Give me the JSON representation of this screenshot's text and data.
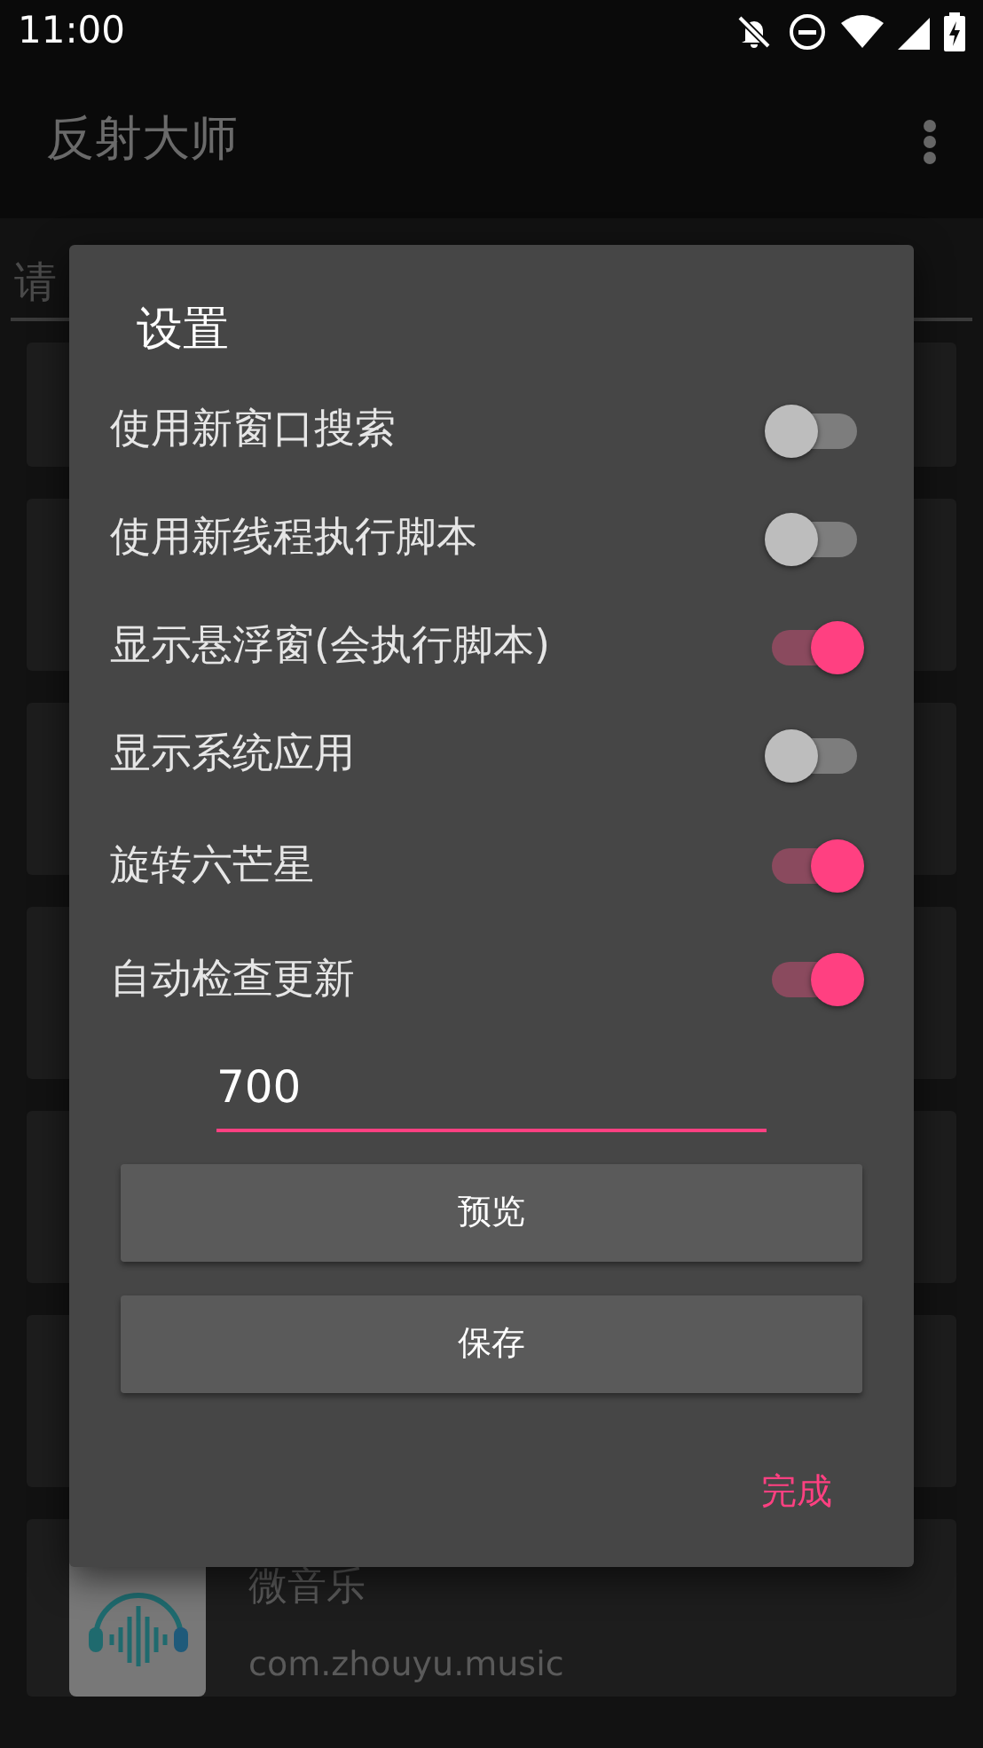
{
  "status_bar": {
    "time": "11:00"
  },
  "app_bar": {
    "title": "反射大师"
  },
  "search": {
    "placeholder": "请"
  },
  "app_list": [
    {
      "kind": "hidden"
    },
    {
      "kind": "hidden"
    },
    {
      "kind": "hidden"
    },
    {
      "kind": "hidden"
    },
    {
      "kind": "hidden"
    },
    {
      "kind": "hidden"
    },
    {
      "kind": "app",
      "title": "微音乐",
      "package": "com.zhouyu.music"
    }
  ],
  "dialog": {
    "title": "设置",
    "switches": [
      {
        "label": "使用新窗口搜索",
        "on": false
      },
      {
        "label": "使用新线程执行脚本",
        "on": false
      },
      {
        "label": "显示悬浮窗(会执行脚本)",
        "on": true
      },
      {
        "label": "显示系统应用",
        "on": false
      },
      {
        "label": "旋转六芒星",
        "on": true
      },
      {
        "label": "自动检查更新",
        "on": true
      }
    ],
    "input": {
      "value": "700"
    },
    "buttons": [
      "预览",
      "保存"
    ],
    "action": "完成"
  }
}
